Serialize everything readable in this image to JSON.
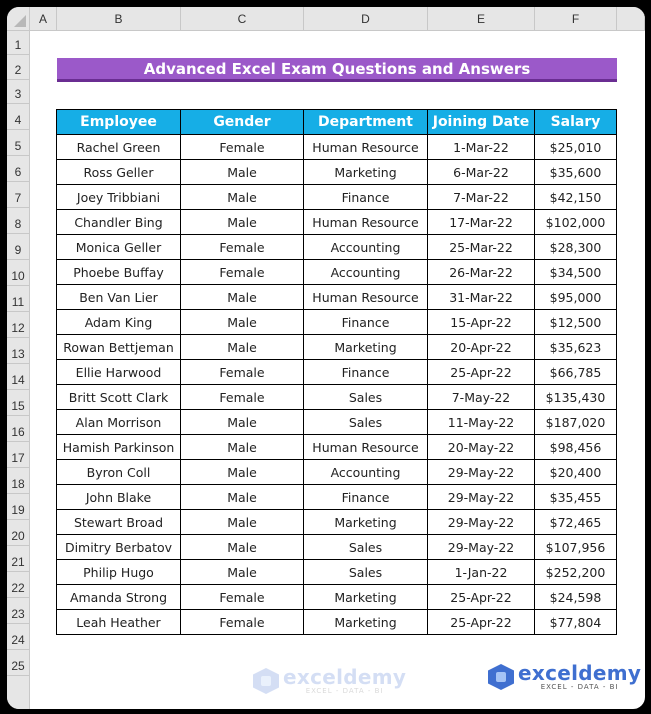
{
  "spreadsheet": {
    "column_headers": [
      "A",
      "B",
      "C",
      "D",
      "E",
      "F"
    ],
    "row_headers": [
      "1",
      "2",
      "3",
      "4",
      "5",
      "6",
      "7",
      "8",
      "9",
      "10",
      "11",
      "12",
      "13",
      "14",
      "15",
      "16",
      "17",
      "18",
      "19",
      "20",
      "21",
      "22",
      "23",
      "24",
      "25"
    ]
  },
  "title": "Advanced Excel Exam Questions and Answers",
  "colors": {
    "title_bg": "#9b59c9",
    "header_bg": "#16aee6",
    "brand": "#3f6fd0"
  },
  "table": {
    "headers": [
      "Employee",
      "Gender",
      "Department",
      "Joining Date",
      "Salary"
    ],
    "rows": [
      [
        "Rachel Green",
        "Female",
        "Human Resource",
        "1-Mar-22",
        "$25,010"
      ],
      [
        "Ross Geller",
        "Male",
        "Marketing",
        "6-Mar-22",
        "$35,600"
      ],
      [
        "Joey Tribbiani",
        "Male",
        "Finance",
        "7-Mar-22",
        "$42,150"
      ],
      [
        "Chandler Bing",
        "Male",
        "Human Resource",
        "17-Mar-22",
        "$102,000"
      ],
      [
        "Monica Geller",
        "Female",
        "Accounting",
        "25-Mar-22",
        "$28,300"
      ],
      [
        "Phoebe Buffay",
        "Female",
        "Accounting",
        "26-Mar-22",
        "$34,500"
      ],
      [
        "Ben Van Lier",
        "Male",
        "Human Resource",
        "31-Mar-22",
        "$95,000"
      ],
      [
        "Adam King",
        "Male",
        "Finance",
        "15-Apr-22",
        "$12,500"
      ],
      [
        "Rowan Bettjeman",
        "Male",
        "Marketing",
        "20-Apr-22",
        "$35,623"
      ],
      [
        "Ellie Harwood",
        "Female",
        "Finance",
        "25-Apr-22",
        "$66,785"
      ],
      [
        "Britt Scott Clark",
        "Female",
        "Sales",
        "7-May-22",
        "$135,430"
      ],
      [
        "Alan Morrison",
        "Male",
        "Sales",
        "11-May-22",
        "$187,020"
      ],
      [
        "Hamish Parkinson",
        "Male",
        "Human Resource",
        "20-May-22",
        "$98,456"
      ],
      [
        "Byron Coll",
        "Male",
        "Accounting",
        "29-May-22",
        "$20,400"
      ],
      [
        "John Blake",
        "Male",
        "Finance",
        "29-May-22",
        "$35,455"
      ],
      [
        "Stewart Broad",
        "Male",
        "Marketing",
        "29-May-22",
        "$72,465"
      ],
      [
        "Dimitry Berbatov",
        "Male",
        "Sales",
        "29-May-22",
        "$107,956"
      ],
      [
        "Philip Hugo",
        "Male",
        "Sales",
        "1-Jan-22",
        "$252,200"
      ],
      [
        "Amanda Strong",
        "Female",
        "Marketing",
        "25-Apr-22",
        "$24,598"
      ],
      [
        "Leah Heather",
        "Female",
        "Marketing",
        "25-Apr-22",
        "$77,804"
      ]
    ]
  },
  "watermark": {
    "brand": "exceldemy",
    "tagline": "EXCEL - DATA - BI"
  }
}
